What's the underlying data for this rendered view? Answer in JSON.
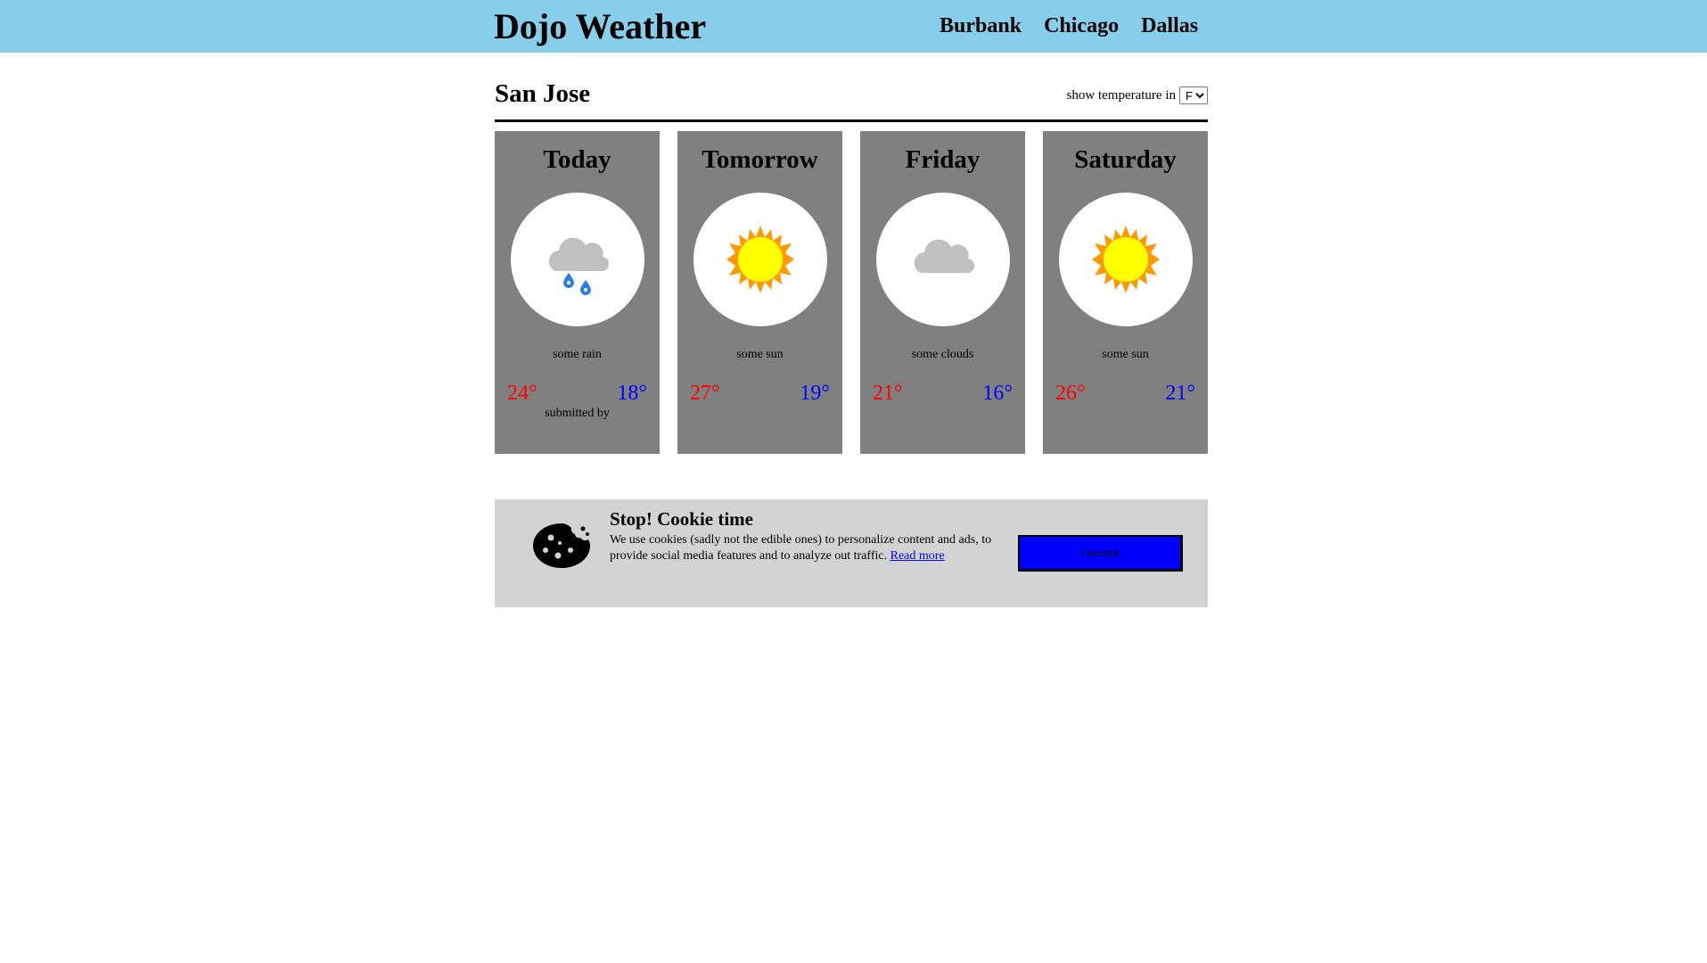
{
  "header": {
    "title": "Dojo Weather",
    "links": [
      "Burbank",
      "Chicago",
      "Dallas"
    ]
  },
  "city": {
    "name": "San Jose",
    "unit_label": "show temperature in",
    "unit_selected": "F"
  },
  "forecast": [
    {
      "day": "Today",
      "icon": "rain-cloud-icon",
      "desc": "some rain",
      "high": "24°",
      "low": "18°",
      "submitted": "submitted by"
    },
    {
      "day": "Tomorrow",
      "icon": "sun-icon",
      "desc": "some sun",
      "high": "27°",
      "low": "19°"
    },
    {
      "day": "Friday",
      "icon": "cloud-icon",
      "desc": "some clouds",
      "high": "21°",
      "low": "16°"
    },
    {
      "day": "Saturday",
      "icon": "sun-icon",
      "desc": "some sun",
      "high": "26°",
      "low": "21°"
    }
  ],
  "cookie": {
    "icon": "cookie-icon",
    "title": "Stop! Cookie time",
    "text": "We use cookies (sadly not the edible ones) to personalize content and ads, to provide social media features and to analyze out traffic.",
    "link": "Read more",
    "button": "I accept"
  },
  "colors": {
    "navbar": "#87ceeb",
    "card": "#808080",
    "high_temp": "#ff0000",
    "low_temp": "#0000ff",
    "cookie_banner": "#d3d3d3",
    "accept_button": "#0000ff"
  }
}
